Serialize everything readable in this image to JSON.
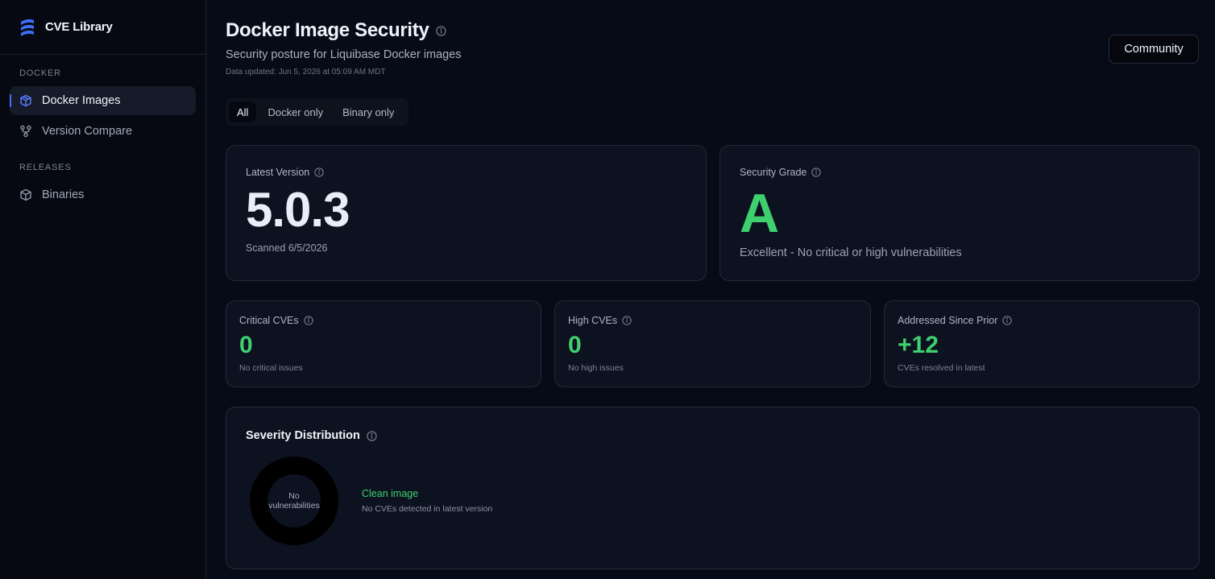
{
  "brand": {
    "name": "CVE Library",
    "icon": "database-icon"
  },
  "sidebar": {
    "sections": [
      {
        "title": "DOCKER",
        "items": [
          {
            "label": "Docker Images",
            "icon": "cube-icon",
            "active": true
          },
          {
            "label": "Version Compare",
            "icon": "git-branch-icon",
            "active": false
          }
        ]
      },
      {
        "title": "RELEASES",
        "items": [
          {
            "label": "Binaries",
            "icon": "package-icon",
            "active": false
          }
        ]
      }
    ]
  },
  "header": {
    "title": "Docker Image Security",
    "subtitle": "Security posture for Liquibase Docker images",
    "updated": "Data updated: Jun 5, 2026 at 05:09 AM MDT",
    "edition_button": "Community"
  },
  "filters": {
    "options": [
      "All",
      "Docker only",
      "Binary only"
    ],
    "selected": "All"
  },
  "latest_version": {
    "label": "Latest Version",
    "value": "5.0.3",
    "scanned": "Scanned 6/5/2026"
  },
  "security_grade": {
    "label": "Security Grade",
    "grade": "A",
    "description": "Excellent - No critical or high vulnerabilities"
  },
  "stats": [
    {
      "label": "Critical CVEs",
      "value": "0",
      "note": "No critical issues"
    },
    {
      "label": "High CVEs",
      "value": "0",
      "note": "No high issues"
    },
    {
      "label": "Addressed Since Prior",
      "value": "+12",
      "note": "CVEs resolved in latest"
    }
  ],
  "severity": {
    "title": "Severity Distribution",
    "donut_line1": "No",
    "donut_line2": "vulnerabilities",
    "status": "Clean image",
    "status_note": "No CVEs detected in latest version"
  },
  "colors": {
    "accent": "#4f6ef7",
    "success": "#3ecf6e",
    "background": "#070b17",
    "card": "#0d1220"
  }
}
